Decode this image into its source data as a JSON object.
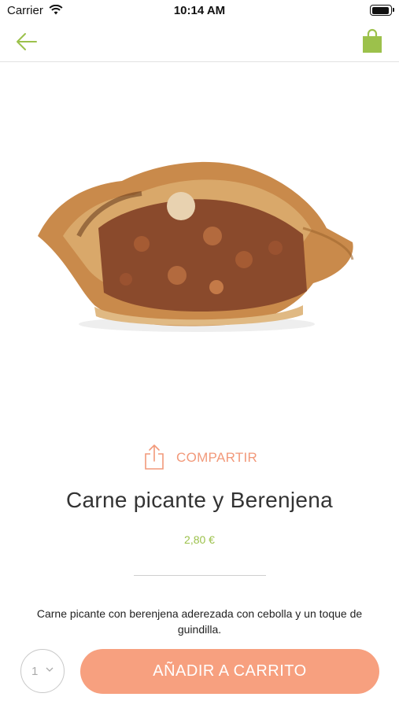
{
  "status_bar": {
    "carrier": "Carrier",
    "time": "10:14 AM"
  },
  "nav": {
    "back_icon": "arrow-left-icon",
    "cart_icon": "shopping-bag-icon",
    "accent": "#9cc14b"
  },
  "product": {
    "image_alt": "Empanada",
    "name": "Carne picante y Berenjena",
    "price": "2,80 €",
    "description": "Carne picante con berenjena aderezada con cebolla y un toque de guindilla."
  },
  "share": {
    "label": "COMPARTIR",
    "icon": "share-icon",
    "color": "#f2997a"
  },
  "cart": {
    "quantity": "1",
    "add_label": "AÑADIR A CARRITO",
    "button_color": "#f7a07f"
  }
}
